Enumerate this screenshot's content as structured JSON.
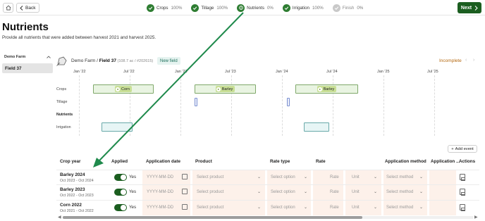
{
  "topbar": {
    "back_label": "Back",
    "steps": [
      {
        "name": "Crops",
        "pct": "100%",
        "state": "done"
      },
      {
        "name": "Tillage",
        "pct": "100%",
        "state": "done"
      },
      {
        "name": "Nutrients",
        "pct": "0%",
        "state": "current"
      },
      {
        "name": "Irrigation",
        "pct": "100%",
        "state": "done"
      },
      {
        "name": "Finish",
        "pct": "0%",
        "state": "disabled"
      }
    ],
    "next_label": "Next"
  },
  "page": {
    "title": "Nutrients",
    "subtitle": "Provide all nutrients that were added between harvest 2021 and harvest 2025."
  },
  "sidebar": {
    "farm": "Demo Farm",
    "fields": [
      "Field 37"
    ]
  },
  "field": {
    "farm": "Demo Farm",
    "sep": " / ",
    "name": "Field 37",
    "meta": " (108.7 ac / #202615)",
    "badge": "New field",
    "status": "Incomplete"
  },
  "timeline": {
    "months": [
      "Jan '22",
      "Jul '22",
      "Jan '23",
      "Jul '23",
      "Jan '24",
      "Jul '24",
      "Jan '25",
      "Jul '25"
    ],
    "rows": [
      "Crops",
      "Tillage",
      "Nutrients",
      "Irrigation"
    ],
    "crops": [
      "Corn",
      "Barley",
      "Barley"
    ]
  },
  "add_event_label": "Add event",
  "table": {
    "headers": [
      "Crop year",
      "Applied",
      "Application date",
      "Product",
      "Rate type",
      "Rate",
      "Application method",
      "Application ...",
      "Actions"
    ],
    "rows": [
      {
        "crop": "Barley 2024",
        "range": "Oct 2023 - Oct 2024",
        "applied": "Yes",
        "date_ph": "YYYY-MM-DD",
        "product_ph": "Select product",
        "rate_type_ph": "Select option",
        "rate_ph": "Rate",
        "unit_ph": "Unit",
        "method_ph": "Select method"
      },
      {
        "crop": "Barley 2023",
        "range": "Oct 2022 - Oct 2023",
        "applied": "Yes",
        "date_ph": "YYYY-MM-DD",
        "product_ph": "Select product",
        "rate_type_ph": "Select option",
        "rate_ph": "Rate",
        "unit_ph": "Unit",
        "method_ph": "Select method"
      },
      {
        "crop": "Corn 2022",
        "range": "Oct 2021 - Oct 2022",
        "applied": "Yes",
        "date_ph": "YYYY-MM-DD",
        "product_ph": "Select product",
        "rate_type_ph": "Select option",
        "rate_ph": "Rate",
        "unit_ph": "Unit",
        "method_ph": "Select method"
      }
    ]
  },
  "colors": {
    "brand_green": "#1b5e20",
    "step_done": "#2e7d32",
    "incomplete": "#b56a12",
    "input_bg": "#fdf1ea",
    "annotation_arrow": "#1f8a4c"
  }
}
